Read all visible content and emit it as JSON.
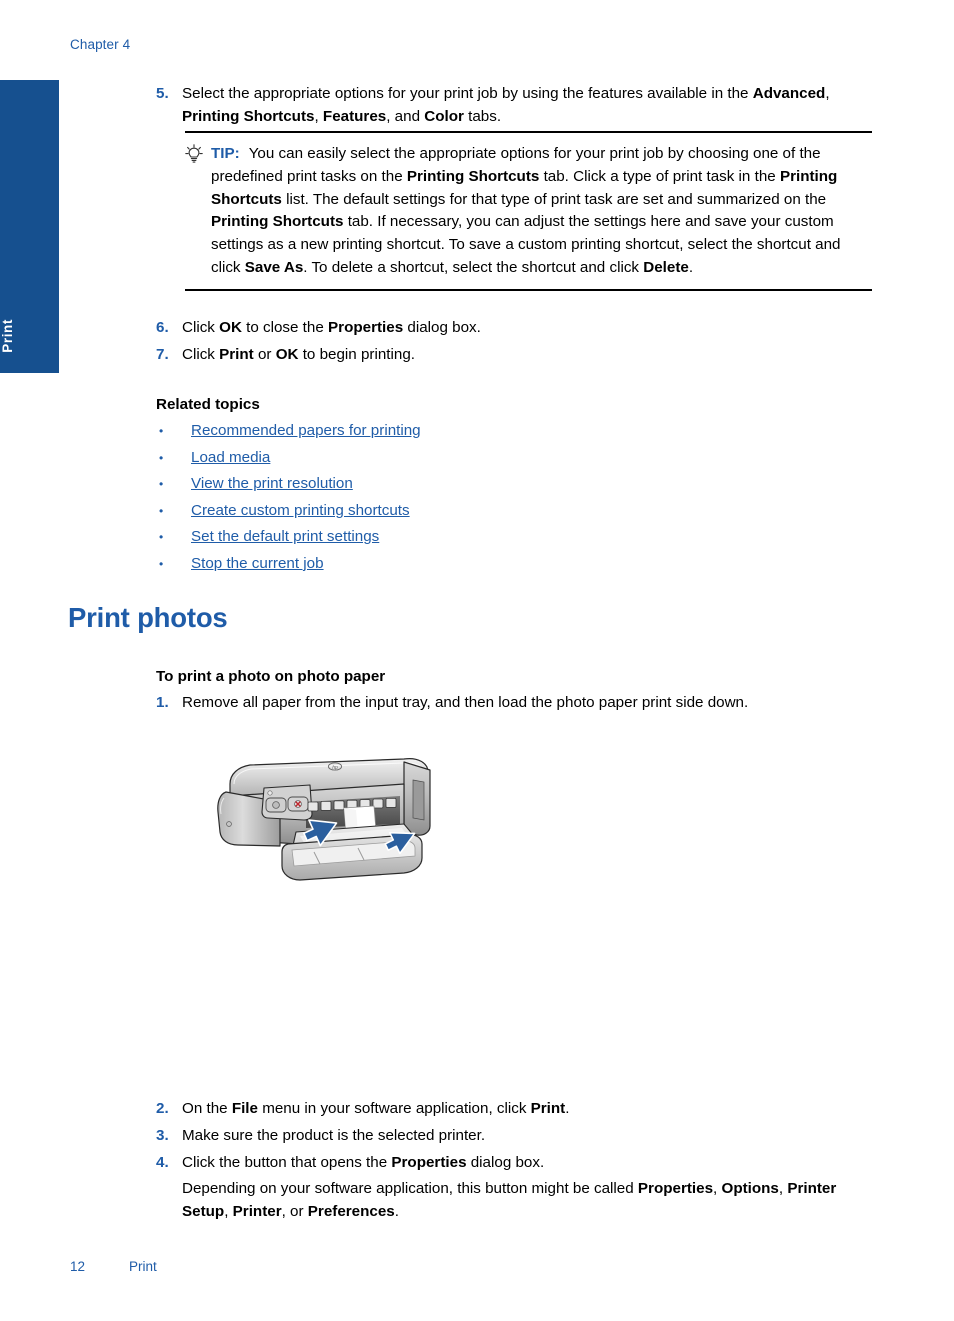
{
  "header": {
    "chapter": "Chapter 4"
  },
  "side_tab": {
    "label": "Print",
    "color": "#16508f"
  },
  "colors": {
    "accent_blue": "#1f5ca8",
    "tab_blue": "#16508f",
    "link_blue": "#1f5ca8",
    "arrow_blue": "#2b5f9e"
  },
  "steps_top": [
    {
      "num": "5.",
      "segments": [
        {
          "text": "Select the appropriate options for your print job by using the features available in the ",
          "bold": false
        },
        {
          "text": "Advanced",
          "bold": true
        },
        {
          "text": ", ",
          "bold": false
        },
        {
          "text": "Printing Shortcuts",
          "bold": true
        },
        {
          "text": ", ",
          "bold": false
        },
        {
          "text": "Features",
          "bold": true
        },
        {
          "text": ", and ",
          "bold": false
        },
        {
          "text": "Color",
          "bold": true
        },
        {
          "text": " tabs.",
          "bold": false
        }
      ]
    },
    {
      "num": "6.",
      "segments": [
        {
          "text": "Click ",
          "bold": false
        },
        {
          "text": "OK",
          "bold": true
        },
        {
          "text": " to close the ",
          "bold": false
        },
        {
          "text": "Properties",
          "bold": true
        },
        {
          "text": " dialog box.",
          "bold": false
        }
      ]
    },
    {
      "num": "7.",
      "segments": [
        {
          "text": "Click ",
          "bold": false
        },
        {
          "text": "Print",
          "bold": true
        },
        {
          "text": " or ",
          "bold": false
        },
        {
          "text": "OK",
          "bold": true
        },
        {
          "text": " to begin printing.",
          "bold": false
        }
      ]
    }
  ],
  "tip": {
    "icon": "lightbulb-icon",
    "label": "TIP:",
    "segments": [
      {
        "text": "You can easily select the appropriate options for your print job by choosing one of the predefined print tasks on the ",
        "bold": false
      },
      {
        "text": "Printing Shortcuts",
        "bold": true
      },
      {
        "text": " tab. Click a type of print task in the ",
        "bold": false
      },
      {
        "text": "Printing Shortcuts",
        "bold": true
      },
      {
        "text": " list. The default settings for that type of print task are set and summarized on the ",
        "bold": false
      },
      {
        "text": "Printing Shortcuts",
        "bold": true
      },
      {
        "text": " tab. If necessary, you can adjust the settings here and save your custom settings as a new printing shortcut. To save a custom printing shortcut, select the shortcut and click ",
        "bold": false
      },
      {
        "text": "Save As",
        "bold": true
      },
      {
        "text": ". To delete a shortcut, select the shortcut and click ",
        "bold": false
      },
      {
        "text": "Delete",
        "bold": true
      },
      {
        "text": ".",
        "bold": false
      }
    ]
  },
  "related": {
    "title": "Related topics",
    "bullet": "•",
    "links": [
      "Recommended papers for printing",
      "Load media",
      "View the print resolution",
      "Create custom printing shortcuts",
      "Set the default print settings",
      "Stop the current job"
    ]
  },
  "section": {
    "heading": "Print photos",
    "procedure_title": "To print a photo on photo paper"
  },
  "steps_bottom": [
    {
      "num": "1.",
      "segments": [
        {
          "text": "Remove all paper from the input tray, and then load the photo paper print side down.",
          "bold": false
        }
      ]
    },
    {
      "num": "2.",
      "segments": [
        {
          "text": "On the ",
          "bold": false
        },
        {
          "text": "File",
          "bold": true
        },
        {
          "text": " menu in your software application, click ",
          "bold": false
        },
        {
          "text": "Print",
          "bold": true
        },
        {
          "text": ".",
          "bold": false
        }
      ]
    },
    {
      "num": "3.",
      "segments": [
        {
          "text": "Make sure the product is the selected printer.",
          "bold": false
        }
      ]
    },
    {
      "num": "4.",
      "segments": [
        {
          "text": "Click the button that opens the ",
          "bold": false
        },
        {
          "text": "Properties",
          "bold": true
        },
        {
          "text": " dialog box.",
          "bold": false
        }
      ]
    },
    {
      "num": "",
      "segments": [
        {
          "text": "Depending on your software application, this button might be called ",
          "bold": false
        },
        {
          "text": "Properties",
          "bold": true
        },
        {
          "text": ", ",
          "bold": false
        },
        {
          "text": "Options",
          "bold": true
        },
        {
          "text": ", ",
          "bold": false
        },
        {
          "text": "Printer Setup",
          "bold": true
        },
        {
          "text": ", ",
          "bold": false
        },
        {
          "text": "Printer",
          "bold": true
        },
        {
          "text": ", or ",
          "bold": false
        },
        {
          "text": "Preferences",
          "bold": true
        },
        {
          "text": ".",
          "bold": false
        }
      ]
    }
  ],
  "figure": {
    "name": "printer-illustration",
    "description": "HP Deskjet printer with open paper tray and two blue arrows indicating loading photo paper",
    "brand_mark": "hp"
  },
  "footer": {
    "page_number": "12",
    "section_label": "Print"
  }
}
